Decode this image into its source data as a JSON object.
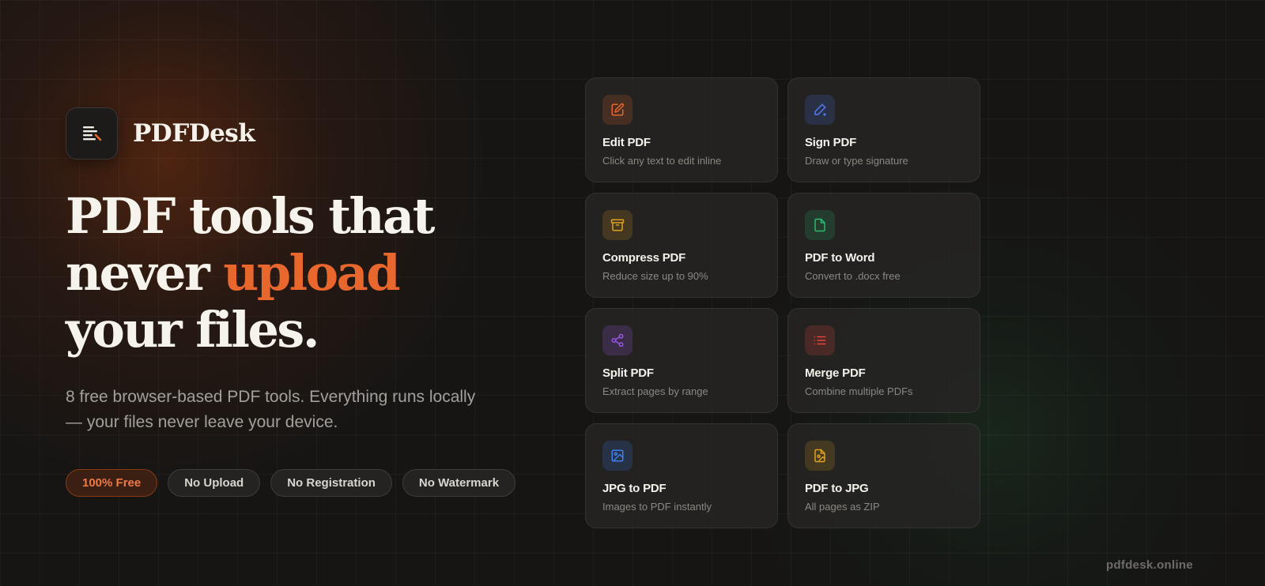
{
  "brand": {
    "name": "PDFDesk",
    "logo_icon": "document-lines-icon"
  },
  "hero": {
    "line1": "PDF tools that",
    "line2_prefix": "never ",
    "line2_highlight": "upload",
    "line3": "your files.",
    "subtitle": "8 free browser-based PDF tools. Everything runs locally — your files never leave your device.",
    "accent_color": "#e8672c"
  },
  "badges": [
    {
      "label": "100% Free"
    },
    {
      "label": "No Upload"
    },
    {
      "label": "No Registration"
    },
    {
      "label": "No Watermark"
    }
  ],
  "tools": [
    {
      "title": "Edit PDF",
      "description": "Click any text to edit inline",
      "icon": "edit-icon",
      "color": "#e8672c"
    },
    {
      "title": "Sign PDF",
      "description": "Draw or type signature",
      "icon": "pen-icon",
      "color": "#4d7cf0"
    },
    {
      "title": "Compress PDF",
      "description": "Reduce size up to 90%",
      "icon": "archive-icon",
      "color": "#e0a11f"
    },
    {
      "title": "PDF to Word",
      "description": "Convert to .docx free",
      "icon": "file-icon",
      "color": "#2eb86b"
    },
    {
      "title": "Split PDF",
      "description": "Extract pages by range",
      "icon": "share-icon",
      "color": "#9a55e8"
    },
    {
      "title": "Merge PDF",
      "description": "Combine multiple PDFs",
      "icon": "list-icon",
      "color": "#e2443b"
    },
    {
      "title": "JPG to PDF",
      "description": "Images to PDF instantly",
      "icon": "image-icon",
      "color": "#3d7ff0"
    },
    {
      "title": "PDF to JPG",
      "description": "All pages as ZIP",
      "icon": "file-image-icon",
      "color": "#e0a11f"
    }
  ],
  "footer": {
    "domain": "pdfdesk.online"
  }
}
